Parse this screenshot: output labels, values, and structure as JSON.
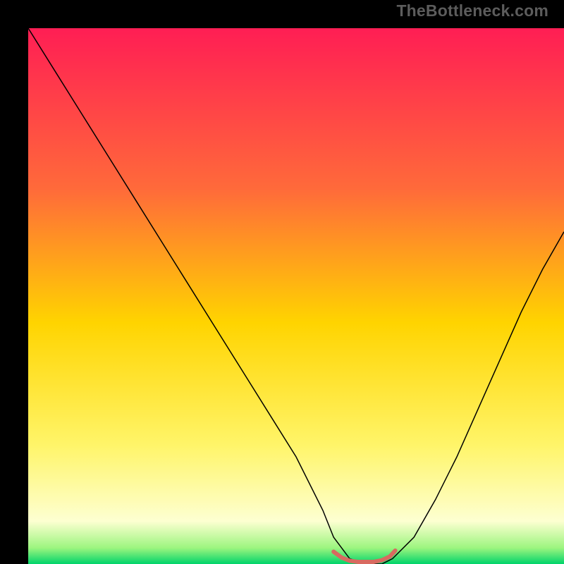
{
  "watermark": "TheBottleneck.com",
  "chart_data": {
    "type": "line",
    "title": "",
    "xlabel": "",
    "ylabel": "",
    "xlim": [
      0,
      100
    ],
    "ylim": [
      0,
      100
    ],
    "grid": false,
    "legend": false,
    "background_gradient": [
      {
        "pct": 0.0,
        "color": "#ff1e54"
      },
      {
        "pct": 0.3,
        "color": "#ff6a3a"
      },
      {
        "pct": 0.55,
        "color": "#ffd400"
      },
      {
        "pct": 0.78,
        "color": "#fff56a"
      },
      {
        "pct": 0.92,
        "color": "#fdffd1"
      },
      {
        "pct": 0.97,
        "color": "#9cf57f"
      },
      {
        "pct": 1.0,
        "color": "#00d46a"
      }
    ],
    "series": [
      {
        "name": "bottleneck-curve",
        "stroke": "#000000",
        "stroke_width": 1.5,
        "x": [
          0,
          5,
          10,
          15,
          20,
          25,
          30,
          35,
          40,
          45,
          50,
          55,
          57,
          60,
          63,
          66,
          68,
          72,
          76,
          80,
          84,
          88,
          92,
          96,
          100
        ],
        "y": [
          100,
          92,
          84,
          76,
          68,
          60,
          52,
          44,
          36,
          28,
          20,
          10,
          5,
          1,
          0,
          0,
          1,
          5,
          12,
          20,
          29,
          38,
          47,
          55,
          62
        ]
      },
      {
        "name": "sweet-spot-marker",
        "stroke": "#d86a60",
        "stroke_width": 6,
        "linecap": "round",
        "x": [
          57,
          58.5,
          60,
          61.5,
          63,
          64.5,
          66,
          67.5,
          68.5
        ],
        "y": [
          2.3,
          1.2,
          0.6,
          0.4,
          0.4,
          0.4,
          0.7,
          1.4,
          2.5
        ]
      }
    ]
  }
}
